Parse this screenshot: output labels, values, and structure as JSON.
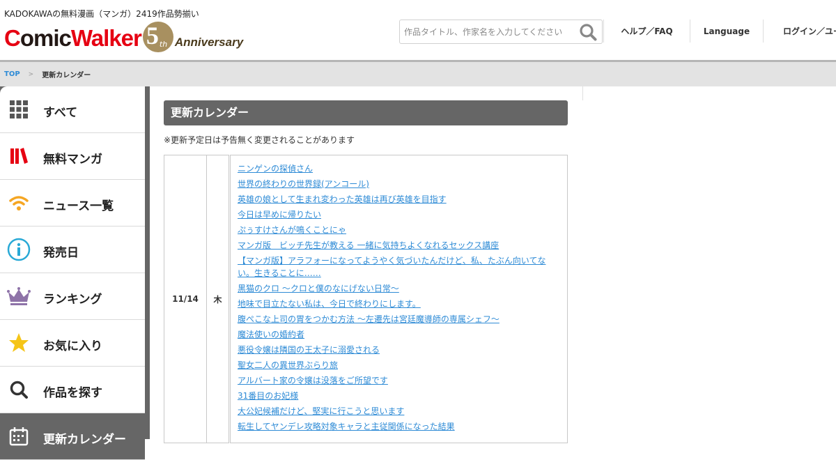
{
  "header": {
    "tagline": "KADOKAWAの無料漫画（マンガ）2419作品勢揃い",
    "logo": {
      "text_c": "C",
      "text_omic": "omic",
      "text_walker": "Walker",
      "badge_num": "5",
      "badge_suffix": "th",
      "anniversary": "Anniversary"
    },
    "search": {
      "placeholder": "作品タイトル、作家名を入力してください",
      "value": ""
    },
    "nav": {
      "help": "ヘルプ／FAQ",
      "language": "Language",
      "login": "ログイン／ユー"
    }
  },
  "breadcrumb": {
    "top": "TOP",
    "separator": ">",
    "current": "更新カレンダー"
  },
  "sidebar": {
    "items": [
      {
        "label": "すべて",
        "icon": "grid-icon",
        "color": "#555555"
      },
      {
        "label": "無料マンガ",
        "icon": "books-icon",
        "color": "#e60012"
      },
      {
        "label": "ニュース一覧",
        "icon": "wifi-icon",
        "color": "#f5a623"
      },
      {
        "label": "発売日",
        "icon": "info-icon",
        "color": "#29a9d6"
      },
      {
        "label": "ランキング",
        "icon": "crown-icon",
        "color": "#8e73a8"
      },
      {
        "label": "お気に入り",
        "icon": "star-icon",
        "color": "#f5c518"
      },
      {
        "label": "作品を探す",
        "icon": "search-icon",
        "color": "#333333"
      },
      {
        "label": "更新カレンダー",
        "icon": "calendar-icon",
        "color": "#ffffff"
      }
    ]
  },
  "main": {
    "title": "更新カレンダー",
    "note": "※更新予定日は予告無く変更されることがあります",
    "rows": [
      {
        "date": "11/14",
        "day": "木",
        "titles": [
          "ニンゲンの探偵さん",
          "世界の終わりの世界録(アンコール)",
          "英雄の娘として生まれ変わった英雄は再び英雄を目指す",
          "今日は早めに帰りたい",
          "ぷぅすけさんが鳴くことにゃ",
          "マンガ版　ビッチ先生が教える 一緒に気持ちよくなれるセックス講座",
          "【マンガ版】アラフォーになってようやく気づいたんだけど、私、たぶん向いてない。生きることに……",
          "黒猫のクロ ～クロと僕のなにげない日常～",
          "地味で目立たない私は、今日で終わりにします。",
          "腹ぺこな上司の胃をつかむ方法 ～左遷先は宮廷魔導師の専属シェフ～",
          "魔法使いの婚約者",
          "悪役令嬢は隣国の王太子に溺愛される",
          "聖女二人の異世界ぶらり旅",
          "アルバート家の令嬢は没落をご所望です",
          "31番目のお妃様",
          "大公妃候補だけど、堅実に行こうと思います",
          "転生してヤンデレ攻略対象キャラと主従関係になった結果"
        ]
      }
    ]
  },
  "colors": {
    "brand_red": "#e60012",
    "link_blue": "#2e8bd6",
    "sidebar_gray": "#666666",
    "anniversary_gold": "#a89060"
  }
}
